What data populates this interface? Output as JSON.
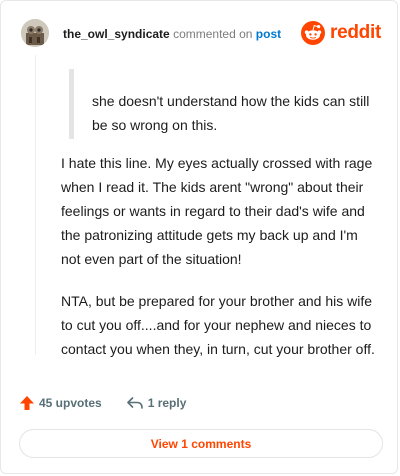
{
  "header": {
    "username": "the_owl_syndicate",
    "action_text": "commented on",
    "post_link": "post",
    "logo_text": "reddit"
  },
  "comment": {
    "quote": "she doesn't understand how the kids can still be so wrong on this.",
    "paragraphs": [
      "I hate this line. My eyes actually crossed with rage when I read it. The kids arent \"wrong\" about their feelings or wants in regard to their dad's wife and the patronizing attitude gets my back up and I'm not even part of the situation!",
      "NTA, but be prepared for your brother and his wife to cut you off....and for your nephew and nieces to contact you when they, in turn, cut your brother off."
    ]
  },
  "footer": {
    "upvotes": "45 upvotes",
    "replies": "1 reply",
    "view_button": "View 1 comments"
  },
  "colors": {
    "brand": "#ff4500",
    "link": "#0079d3",
    "muted": "#576f76"
  }
}
